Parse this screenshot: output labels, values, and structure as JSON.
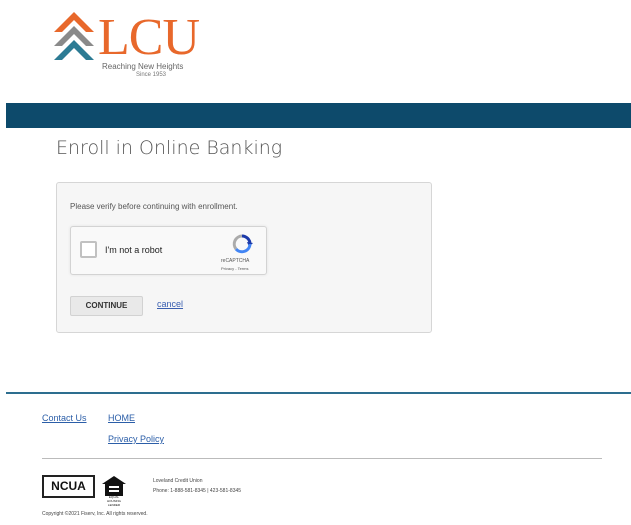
{
  "logo": {
    "text": "LCU",
    "tagline": "Reaching New Heights",
    "since": "Since 1953",
    "colors": {
      "orange": "#e8682b",
      "teal": "#2c7b94",
      "gray": "#8a8a8a"
    }
  },
  "topbar": {
    "color": "#0d4a6b"
  },
  "page_title": "Enroll in Online Banking",
  "panel": {
    "instruction": "Please verify before continuing with enrollment.",
    "captcha": {
      "label": "I'm not a robot",
      "brand": "reCAPTCHA",
      "links": "Privacy - Terms",
      "icon": "recaptcha-icon"
    },
    "continue_label": "CONTINUE",
    "cancel_label": "cancel"
  },
  "footer": {
    "links": {
      "contact": "Contact Us",
      "home": "HOME",
      "privacy": "Privacy Policy"
    },
    "ncua_label": "NCUA",
    "ehl_text": "EQUAL HOUSING LENDER",
    "cu_name": "Loveland Credit Union",
    "cu_phone": "Phone: 1-888-581-8345   |   423-581-8345",
    "copyright": "Copyright ©2021 Fiserv, Inc. All rights reserved."
  }
}
